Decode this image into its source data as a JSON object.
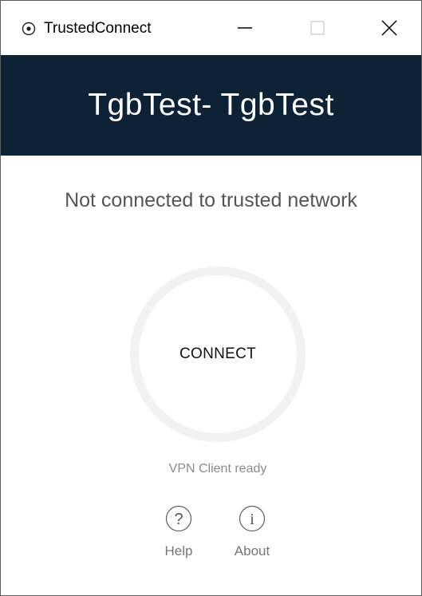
{
  "window": {
    "app_title": "TrustedConnect",
    "app_icon": "target-circle-icon",
    "controls": {
      "minimize_icon": "minimize-icon",
      "maximize_icon": "maximize-icon",
      "close_icon": "close-icon"
    }
  },
  "header": {
    "title": "TgbTest- TgbTest",
    "background_color": "#0e2236"
  },
  "status": {
    "network_text": "Not connected to trusted network",
    "connect_label": "CONNECT",
    "vpn_text": "VPN Client ready"
  },
  "footer": {
    "help": {
      "label": "Help",
      "icon": "question-circle-icon"
    },
    "about": {
      "label": "About",
      "icon": "info-circle-icon"
    }
  }
}
